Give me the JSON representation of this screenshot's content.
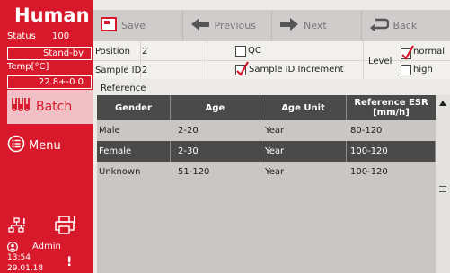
{
  "sidebar": {
    "logo": "Human",
    "status_label": "Status",
    "status_code": "100",
    "status_value": "Stand-by",
    "temp_label": "Temp[°C]",
    "temp_value": "22.8+-0.0",
    "batch_label": "Batch",
    "menu_label": "Menu",
    "user_label": "Admin",
    "time": "13:54",
    "date": "29.01.18",
    "alert": "!"
  },
  "toolbar": {
    "save_label": "Save",
    "previous_label": "Previous",
    "next_label": "Next",
    "back_label": "Back"
  },
  "form": {
    "position_label": "Position",
    "position_value": "2",
    "sample_id_label": "Sample ID",
    "sample_id_value": "2",
    "qc_label": "QC",
    "qc_checked": false,
    "sample_id_increment_label": "Sample ID Increment",
    "sample_id_increment_checked": true,
    "level_label": "Level",
    "normal_label": "normal",
    "normal_checked": true,
    "high_label": "high",
    "high_checked": false
  },
  "reference": {
    "section_label": "Reference",
    "columns": {
      "gender": "Gender",
      "age": "Age",
      "age_unit": "Age Unit",
      "esr_line1": "Reference ESR",
      "esr_line2": "[mm/h]"
    },
    "rows": [
      {
        "gender": "Male",
        "age": "2-20",
        "age_unit": "Year",
        "esr": "80-120",
        "selected": false
      },
      {
        "gender": "Female",
        "age": "2-30",
        "age_unit": "Year",
        "esr": "100-120",
        "selected": true
      },
      {
        "gender": "Unknown",
        "age": "51-120",
        "age_unit": "Year",
        "esr": "100-120",
        "selected": false
      }
    ]
  },
  "colors": {
    "brand_red": "#d7192b",
    "batch_highlight": "#f0c0c6",
    "header_dark": "#4a4a4a",
    "check_red": "#d7192b"
  }
}
